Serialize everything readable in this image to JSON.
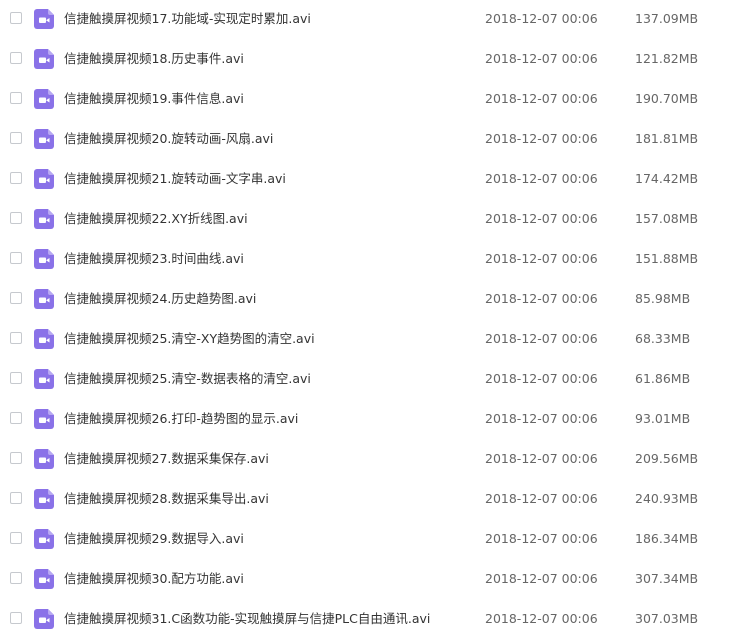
{
  "icon": {
    "name": "video-file-icon",
    "color": "#8a72e8"
  },
  "files": [
    {
      "name": "信捷触摸屏视频17.功能域-实现定时累加.avi",
      "date": "2018-12-07 00:06",
      "size": "137.09MB"
    },
    {
      "name": "信捷触摸屏视频18.历史事件.avi",
      "date": "2018-12-07 00:06",
      "size": "121.82MB"
    },
    {
      "name": "信捷触摸屏视频19.事件信息.avi",
      "date": "2018-12-07 00:06",
      "size": "190.70MB"
    },
    {
      "name": "信捷触摸屏视频20.旋转动画-风扇.avi",
      "date": "2018-12-07 00:06",
      "size": "181.81MB"
    },
    {
      "name": "信捷触摸屏视频21.旋转动画-文字串.avi",
      "date": "2018-12-07 00:06",
      "size": "174.42MB"
    },
    {
      "name": "信捷触摸屏视频22.XY折线图.avi",
      "date": "2018-12-07 00:06",
      "size": "157.08MB"
    },
    {
      "name": "信捷触摸屏视频23.时间曲线.avi",
      "date": "2018-12-07 00:06",
      "size": "151.88MB"
    },
    {
      "name": "信捷触摸屏视频24.历史趋势图.avi",
      "date": "2018-12-07 00:06",
      "size": "85.98MB"
    },
    {
      "name": "信捷触摸屏视频25.清空-XY趋势图的清空.avi",
      "date": "2018-12-07 00:06",
      "size": "68.33MB"
    },
    {
      "name": "信捷触摸屏视频25.清空-数据表格的清空.avi",
      "date": "2018-12-07 00:06",
      "size": "61.86MB"
    },
    {
      "name": "信捷触摸屏视频26.打印-趋势图的显示.avi",
      "date": "2018-12-07 00:06",
      "size": "93.01MB"
    },
    {
      "name": "信捷触摸屏视频27.数据采集保存.avi",
      "date": "2018-12-07 00:06",
      "size": "209.56MB"
    },
    {
      "name": "信捷触摸屏视频28.数据采集导出.avi",
      "date": "2018-12-07 00:06",
      "size": "240.93MB"
    },
    {
      "name": "信捷触摸屏视频29.数据导入.avi",
      "date": "2018-12-07 00:06",
      "size": "186.34MB"
    },
    {
      "name": "信捷触摸屏视频30.配方功能.avi",
      "date": "2018-12-07 00:06",
      "size": "307.34MB"
    },
    {
      "name": "信捷触摸屏视频31.C函数功能-实现触摸屏与信捷PLC自由通讯.avi",
      "date": "2018-12-07 00:06",
      "size": "307.03MB"
    }
  ]
}
